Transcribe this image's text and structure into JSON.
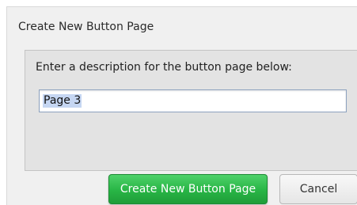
{
  "dialog": {
    "title": "Create New Button Page",
    "prompt": "Enter a description for the button page below:",
    "field_value": "Page 3",
    "primary_button": "Create New Button Page",
    "cancel_button": "Cancel"
  },
  "colors": {
    "primary_button": "#28b545",
    "dialog_background": "#f0f0f0",
    "selection_highlight": "#c5d6f2"
  }
}
